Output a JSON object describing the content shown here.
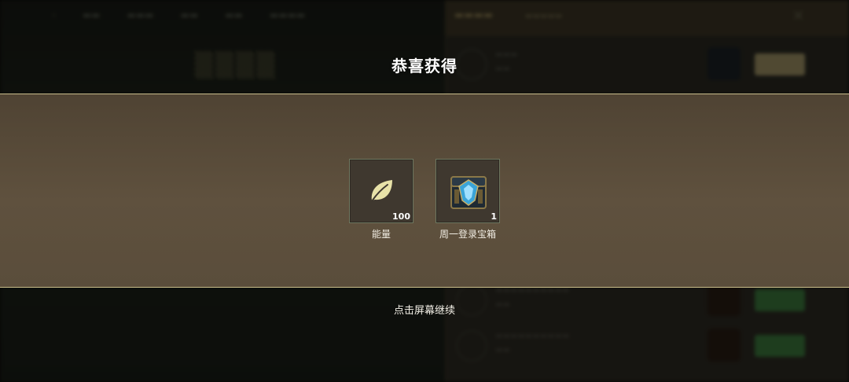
{
  "popup": {
    "title": "恭喜获得",
    "continue_hint": "点击屏幕继续",
    "rewards": [
      {
        "name": "能量",
        "count": "100",
        "icon": "leaf-icon"
      },
      {
        "name": "周一登录宝箱",
        "count": "1",
        "icon": "treasure-chest-icon"
      }
    ]
  },
  "colors": {
    "band_top": "#4f4333",
    "band_bottom": "#5a4d3b",
    "band_border": "#c9bd8a",
    "item_border": "#6e7760",
    "leaf": "#e8e2a8"
  }
}
